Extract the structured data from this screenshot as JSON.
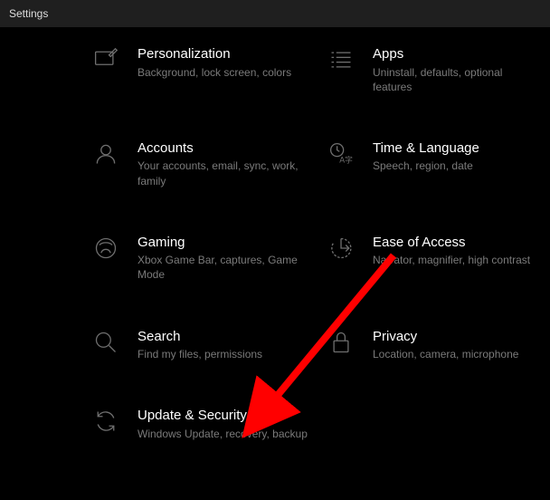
{
  "window": {
    "title": "Settings"
  },
  "tiles": [
    {
      "title": "Personalization",
      "subtitle": "Background, lock screen, colors"
    },
    {
      "title": "Apps",
      "subtitle": "Uninstall, defaults, optional features"
    },
    {
      "title": "Accounts",
      "subtitle": "Your accounts, email, sync, work, family"
    },
    {
      "title": "Time & Language",
      "subtitle": "Speech, region, date"
    },
    {
      "title": "Gaming",
      "subtitle": "Xbox Game Bar, captures, Game Mode"
    },
    {
      "title": "Ease of Access",
      "subtitle": "Narrator, magnifier, high contrast"
    },
    {
      "title": "Search",
      "subtitle": "Find my files, permissions"
    },
    {
      "title": "Privacy",
      "subtitle": "Location, camera, microphone"
    },
    {
      "title": "Update & Security",
      "subtitle": "Windows Update, recovery, backup"
    }
  ],
  "annotation": {
    "arrow_color": "#ff0000"
  }
}
